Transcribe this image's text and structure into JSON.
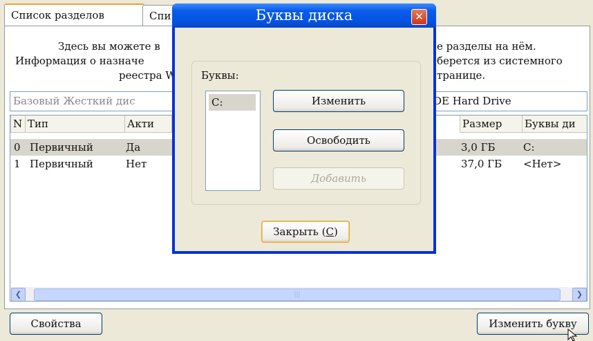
{
  "tabs": [
    "Список разделов",
    "Спи"
  ],
  "description": {
    "left": [
      "Здесь вы можете в",
      "Информация о назначе",
      "реестра W"
    ],
    "right": [
      "е разделы на нём.",
      "берется из системного",
      "транице."
    ]
  },
  "disk": {
    "name_partial": "Базовый Жесткий дис",
    "model_partial": "DE Hard Drive"
  },
  "columns": [
    "N",
    "Тип",
    "Акти",
    "Размер",
    "Буквы ди"
  ],
  "rows": [
    {
      "n": "0",
      "type": "Первичный",
      "active": "Да",
      "size": "3,0 ГБ",
      "letters": "C:"
    },
    {
      "n": "1",
      "type": "Первичный",
      "active": "Нет",
      "size": "37,0 ГБ",
      "letters": "<Нет>"
    }
  ],
  "buttons": {
    "properties": "Свойства",
    "change_letter": "Изменить букву"
  },
  "dialog": {
    "title": "Буквы диска",
    "group_label": "Буквы:",
    "letters": [
      "C:"
    ],
    "change": "Изменить",
    "release": "Освободить",
    "add": "Добавить",
    "close_prefix": "Закрыть (",
    "close_hotkey": "C",
    "close_suffix": ")"
  },
  "icons": [
    "close-icon",
    "scroll-left-icon",
    "scroll-right-icon",
    "mouse-cursor-icon"
  ],
  "colors": {
    "titlebar": "#0a5ce8",
    "selection": "#d8d6cc",
    "tab_highlight": "#e8a33d"
  }
}
